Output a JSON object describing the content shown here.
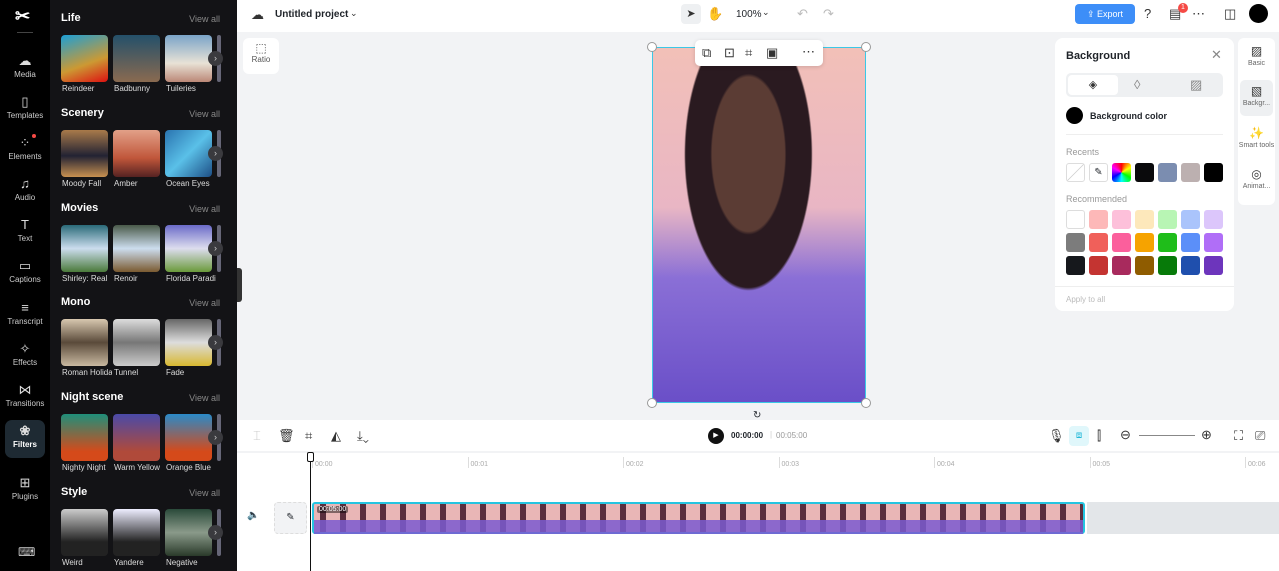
{
  "nav": {
    "items": [
      {
        "label": "Media",
        "icon": "cloud-upload-icon"
      },
      {
        "label": "Templates",
        "icon": "templates-icon"
      },
      {
        "label": "Elements",
        "icon": "elements-icon"
      },
      {
        "label": "Audio",
        "icon": "music-note-icon"
      },
      {
        "label": "Text",
        "icon": "text-icon"
      },
      {
        "label": "Captions",
        "icon": "captions-icon"
      },
      {
        "label": "Transcript",
        "icon": "transcript-icon"
      },
      {
        "label": "Effects",
        "icon": "effects-icon"
      },
      {
        "label": "Transitions",
        "icon": "transitions-icon"
      },
      {
        "label": "Filters",
        "icon": "filters-icon",
        "active": true
      },
      {
        "label": "Plugins",
        "icon": "plugins-icon"
      }
    ]
  },
  "panel": {
    "view_all": "View all",
    "sections": [
      {
        "title": "Life",
        "items": [
          "Reindeer",
          "Badbunny",
          "Tuileries"
        ]
      },
      {
        "title": "Scenery",
        "items": [
          "Moody Fall",
          "Amber",
          "Ocean Eyes"
        ]
      },
      {
        "title": "Movies",
        "items": [
          "Shirley: Real",
          "Renoir",
          "Florida Paradise"
        ]
      },
      {
        "title": "Mono",
        "items": [
          "Roman Holiday",
          "Tunnel",
          "Fade"
        ]
      },
      {
        "title": "Night scene",
        "items": [
          "Nighty Night",
          "Warm Yellow",
          "Orange Blue"
        ]
      },
      {
        "title": "Style",
        "items": [
          "Weird",
          "Yandere",
          "Negative"
        ]
      }
    ]
  },
  "top": {
    "project": "Untitled project",
    "zoom": "100%",
    "export": "Export",
    "notif_count": "1"
  },
  "canvas": {
    "ratio": "Ratio"
  },
  "bgpanel": {
    "title": "Background",
    "color_label": "Background color",
    "recents_label": "Recents",
    "recommended_label": "Recommended",
    "apply_all": "Apply to all",
    "recents": [
      "#0a0a0c",
      "#7b8db0",
      "#bcb0b0",
      "#000000"
    ],
    "recommended": [
      "#ffffff",
      "#fdb8b8",
      "#fdc0da",
      "#fde8bb",
      "#b8f5b4",
      "#aac4fb",
      "#dcc6fb",
      "#7c7c7c",
      "#f0605a",
      "#fb5f9c",
      "#f6a300",
      "#1fbd1a",
      "#5b8ff9",
      "#b06ef7",
      "#16181c",
      "#c43431",
      "#a82a5d",
      "#8f5c00",
      "#077a09",
      "#1f4fad",
      "#6d35bc"
    ]
  },
  "rtabs": [
    "Basic",
    "Backgr...",
    "Smart tools",
    "Animat..."
  ],
  "timeline": {
    "current": "00:00:00",
    "total": "00:05:00",
    "clip_duration": "00:05:00",
    "ticks": [
      "00:00",
      "00:01",
      "00:02",
      "00:03",
      "00:04",
      "00:05",
      "00:06"
    ]
  }
}
